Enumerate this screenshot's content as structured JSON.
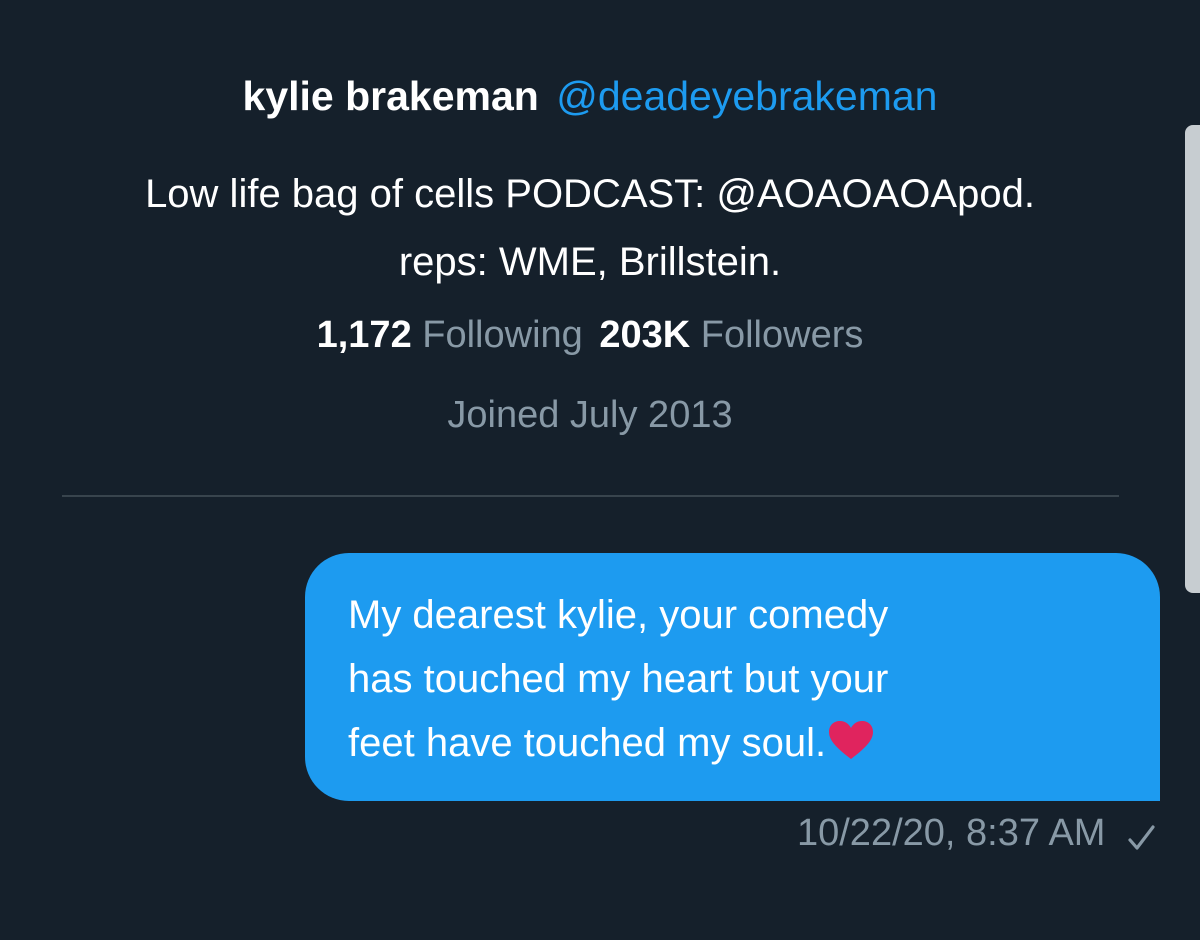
{
  "profile": {
    "display_name": "kylie brakeman",
    "handle": "@deadeyebrakeman",
    "bio_lines": [
      "Low life bag of cells PODCAST: @AOAOAOApod.",
      "reps: WME, Brillstein."
    ],
    "following_count": "1,172",
    "following_label": "Following",
    "followers_count": "203K",
    "followers_label": "Followers",
    "joined": "Joined July 2013"
  },
  "message": {
    "lines": [
      "My dearest kylie, your comedy",
      "has touched my heart but your",
      "feet have touched my soul."
    ],
    "emoji": "heart-emoji",
    "timestamp": "10/22/20, 8:37 AM",
    "status_icon": "checkmark-icon"
  },
  "colors": {
    "background": "#15202b",
    "accent": "#1d9bf0",
    "secondary_text": "#8899a6",
    "heart": "#e0245e"
  }
}
